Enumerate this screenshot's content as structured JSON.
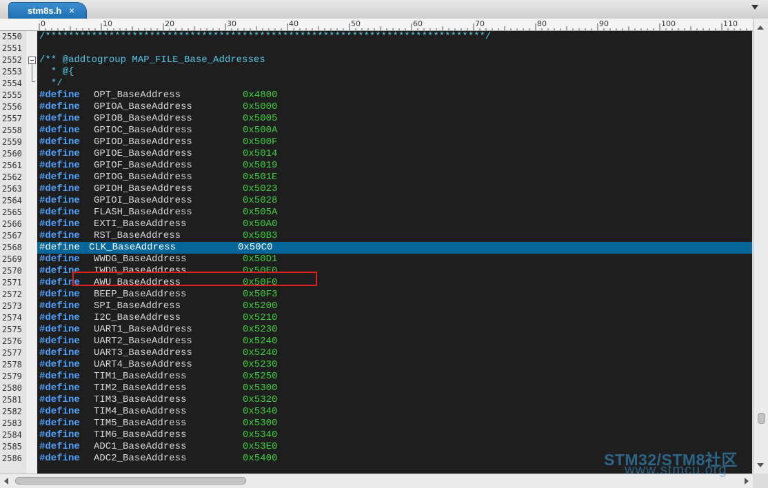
{
  "tab": {
    "label": "stm8s.h",
    "close_glyph": "×",
    "dropdown_icon": "chevron-down-icon"
  },
  "ruler": {
    "labels": [
      "0",
      "10",
      "20",
      "30",
      "40",
      "50",
      "60",
      "70",
      "80",
      "90",
      "100",
      "110"
    ]
  },
  "colors": {
    "editor_bg": "#1e1e1e",
    "keyword": "#4fa3ff",
    "identifier": "#d8d8d8",
    "hex": "#3fcf3f",
    "comment": "#58c7e8",
    "selected_line": "#07679a",
    "selection_outline": "#e02020",
    "tab": "#1f6fb1"
  },
  "editor": {
    "first_line": 2550,
    "selected_line": 2568,
    "lines": [
      {
        "n": "2550",
        "type": "comment",
        "text": "/****************************************************************************/"
      },
      {
        "n": "2551",
        "type": "blank",
        "text": ""
      },
      {
        "n": "2552",
        "type": "comment",
        "text": "/** @addtogroup MAP_FILE_Base_Addresses"
      },
      {
        "n": "2553",
        "type": "comment",
        "text": "  * @{"
      },
      {
        "n": "2554",
        "type": "comment",
        "text": "  */"
      },
      {
        "n": "2555",
        "type": "define",
        "kw": "#define",
        "name": "OPT_BaseAddress",
        "val": "0x4800"
      },
      {
        "n": "2556",
        "type": "define",
        "kw": "#define",
        "name": "GPIOA_BaseAddress",
        "val": "0x5000"
      },
      {
        "n": "2557",
        "type": "define",
        "kw": "#define",
        "name": "GPIOB_BaseAddress",
        "val": "0x5005"
      },
      {
        "n": "2558",
        "type": "define",
        "kw": "#define",
        "name": "GPIOC_BaseAddress",
        "val": "0x500A"
      },
      {
        "n": "2559",
        "type": "define",
        "kw": "#define",
        "name": "GPIOD_BaseAddress",
        "val": "0x500F"
      },
      {
        "n": "2560",
        "type": "define",
        "kw": "#define",
        "name": "GPIOE_BaseAddress",
        "val": "0x5014"
      },
      {
        "n": "2561",
        "type": "define",
        "kw": "#define",
        "name": "GPIOF_BaseAddress",
        "val": "0x5019"
      },
      {
        "n": "2562",
        "type": "define",
        "kw": "#define",
        "name": "GPIOG_BaseAddress",
        "val": "0x501E"
      },
      {
        "n": "2563",
        "type": "define",
        "kw": "#define",
        "name": "GPIOH_BaseAddress",
        "val": "0x5023"
      },
      {
        "n": "2564",
        "type": "define",
        "kw": "#define",
        "name": "GPIOI_BaseAddress",
        "val": "0x5028"
      },
      {
        "n": "2565",
        "type": "define",
        "kw": "#define",
        "name": "FLASH_BaseAddress",
        "val": "0x505A"
      },
      {
        "n": "2566",
        "type": "define",
        "kw": "#define",
        "name": "EXTI_BaseAddress",
        "val": "0x50A0"
      },
      {
        "n": "2567",
        "type": "define",
        "kw": "#define",
        "name": "RST_BaseAddress",
        "val": "0x50B3"
      },
      {
        "n": "2568",
        "type": "define",
        "kw": "#define",
        "name": "CLK_BaseAddress",
        "val": "0x50C0",
        "selected": true
      },
      {
        "n": "2569",
        "type": "define",
        "kw": "#define",
        "name": "WWDG_BaseAddress",
        "val": "0x50D1"
      },
      {
        "n": "2570",
        "type": "define",
        "kw": "#define",
        "name": "IWDG_BaseAddress",
        "val": "0x50E0"
      },
      {
        "n": "2571",
        "type": "define",
        "kw": "#define",
        "name": "AWU_BaseAddress",
        "val": "0x50F0"
      },
      {
        "n": "2572",
        "type": "define",
        "kw": "#define",
        "name": "BEEP_BaseAddress",
        "val": "0x50F3"
      },
      {
        "n": "2573",
        "type": "define",
        "kw": "#define",
        "name": "SPI_BaseAddress",
        "val": "0x5200"
      },
      {
        "n": "2574",
        "type": "define",
        "kw": "#define",
        "name": "I2C_BaseAddress",
        "val": "0x5210"
      },
      {
        "n": "2575",
        "type": "define",
        "kw": "#define",
        "name": "UART1_BaseAddress",
        "val": "0x5230"
      },
      {
        "n": "2576",
        "type": "define",
        "kw": "#define",
        "name": "UART2_BaseAddress",
        "val": "0x5240"
      },
      {
        "n": "2577",
        "type": "define",
        "kw": "#define",
        "name": "UART3_BaseAddress",
        "val": "0x5240"
      },
      {
        "n": "2578",
        "type": "define",
        "kw": "#define",
        "name": "UART4_BaseAddress",
        "val": "0x5230"
      },
      {
        "n": "2579",
        "type": "define",
        "kw": "#define",
        "name": "TIM1_BaseAddress",
        "val": "0x5250"
      },
      {
        "n": "2580",
        "type": "define",
        "kw": "#define",
        "name": "TIM2_BaseAddress",
        "val": "0x5300"
      },
      {
        "n": "2581",
        "type": "define",
        "kw": "#define",
        "name": "TIM3_BaseAddress",
        "val": "0x5320"
      },
      {
        "n": "2582",
        "type": "define",
        "kw": "#define",
        "name": "TIM4_BaseAddress",
        "val": "0x5340"
      },
      {
        "n": "2583",
        "type": "define",
        "kw": "#define",
        "name": "TIM5_BaseAddress",
        "val": "0x5300"
      },
      {
        "n": "2584",
        "type": "define",
        "kw": "#define",
        "name": "TIM6_BaseAddress",
        "val": "0x5340"
      },
      {
        "n": "2585",
        "type": "define",
        "kw": "#define",
        "name": "ADC1_BaseAddress",
        "val": "0x53E0"
      },
      {
        "n": "2586",
        "type": "define",
        "kw": "#define",
        "name": "ADC2_BaseAddress",
        "val": "0x5400"
      }
    ]
  },
  "watermark": {
    "line1": "STM32/STM8社区",
    "line2": "www.stmcu.org"
  }
}
